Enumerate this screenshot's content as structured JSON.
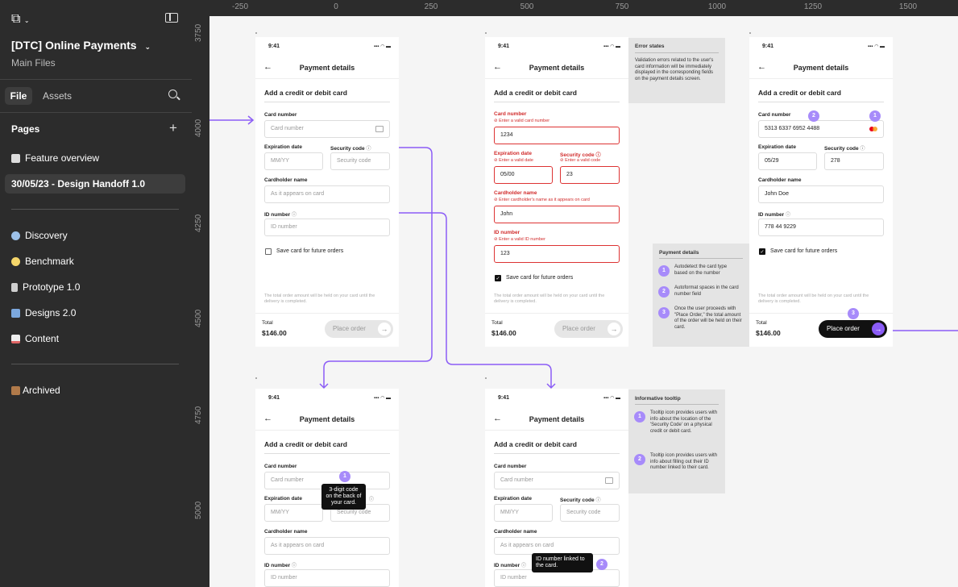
{
  "sidebar": {
    "project_title": "[DTC] Online Payments",
    "project_subtitle": "Main Files",
    "tabs": [
      "File",
      "Assets"
    ],
    "pages_heading": "Pages",
    "pages": [
      {
        "label": "Feature overview",
        "icon": "memo-icon"
      },
      {
        "label": "30/05/23 - Design Handoff 1.0",
        "icon": ""
      }
    ],
    "pages2": [
      {
        "label": "Discovery",
        "icon": "magnifier-icon"
      },
      {
        "label": "Benchmark",
        "icon": "lightbulb-icon"
      },
      {
        "label": "Prototype 1.0",
        "icon": "page-icon"
      },
      {
        "label": "Designs 2.0",
        "icon": "frame-icon"
      },
      {
        "label": "Content",
        "icon": "chart-icon"
      }
    ],
    "archived": {
      "label": "Archived",
      "icon": "box-icon"
    }
  },
  "ruler": {
    "top": [
      "-250",
      "0",
      "250",
      "500",
      "750",
      "1000",
      "1250",
      "1500"
    ],
    "left": [
      "3750",
      "4000",
      "4250",
      "4500",
      "4750",
      "5000"
    ]
  },
  "phone": {
    "time": "9:41",
    "signal": "▪▪▪ ◠ ▬",
    "title": "Payment details",
    "section": "Add a credit or debit card",
    "card_number_label": "Card number",
    "card_number_placeholder": "Card number",
    "expiration_label": "Expiration date",
    "expiration_placeholder": "MM/YY",
    "security_label": "Security code",
    "security_placeholder": "Security code",
    "cardholder_label": "Cardholder name",
    "cardholder_placeholder": "As it appears on card",
    "id_label": "ID number",
    "id_placeholder": "ID number",
    "save_label": "Save card for future orders",
    "note": "The total order amount will be held on your card until the delivery is completed.",
    "total_label": "Total",
    "total_value": "$146.00",
    "place_order": "Place order"
  },
  "errors": {
    "card": "Enter a valid card number",
    "card_value": "1234",
    "exp": "Enter a valid date",
    "exp_value": "05/00",
    "sec": "Enter a valid code",
    "sec_value": "23",
    "name": "Enter cardholder's name as it appears on card",
    "name_value": "John",
    "id": "Enter a valid ID number",
    "id_value": "123"
  },
  "filled": {
    "card": "5313 6337 6952 4488",
    "exp": "05/29",
    "sec": "278",
    "name": "John Doe",
    "id": "778 44 9229"
  },
  "annotations": {
    "error_title": "Error states",
    "error_body": "Validation errors related to the user's card information will be immediately displayed in the corresponding fields on the payment details screen.",
    "payment_title": "Payment details",
    "payment_items": [
      "Autodetect the card type based on the number",
      "Autoformat spaces in the card number field",
      "Once the user proceeds with \"Place Order,\" the total amount of the order will be held on their card."
    ],
    "tooltip_title": "Informative tooltip",
    "tooltip_items": [
      "Tooltip icon provides users with info about the location of the 'Security Code' on a physical credit or debit card.",
      "Tooltip icon provides users with info about filling out their ID number linked to their card."
    ],
    "tip1": "3-digit code on the back of your card.",
    "tip2": "ID number linked to the card.",
    "badges": [
      "1",
      "2",
      "3"
    ]
  },
  "colors": {
    "accent": "#8b5cf6",
    "badge": "#a78bfa",
    "error": "#d12b2b"
  }
}
